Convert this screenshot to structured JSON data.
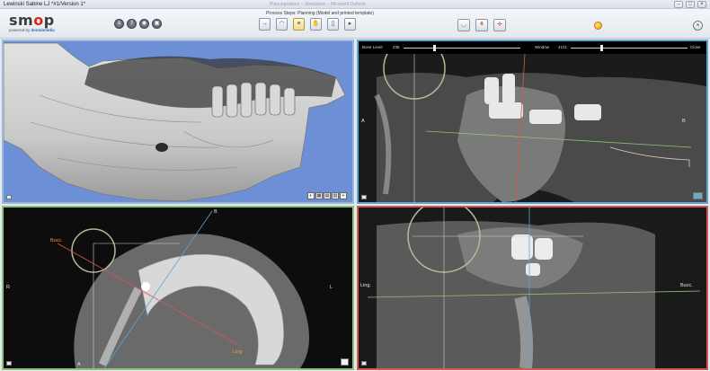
{
  "window": {
    "title": "Lewinski Sabine  LJ  *#1/Version 1*",
    "center_caption": "Planungsdaten – Simulation – Microsoft Outlook",
    "controls": [
      "–",
      "□",
      "×"
    ]
  },
  "logo": {
    "wordmark_left": "sm",
    "wordmark_o": "o",
    "wordmark_right": "p",
    "tagline_prefix": "powered by ",
    "tagline_brand": "dentalmedia"
  },
  "toolbar": {
    "left_buttons": [
      {
        "name": "menu-button",
        "icon": "menu-icon",
        "glyph": "≡"
      },
      {
        "name": "help-button",
        "icon": "help-icon",
        "glyph": "?"
      },
      {
        "name": "visibility-button",
        "icon": "eye-icon",
        "glyph": "◉"
      },
      {
        "name": "camera-button",
        "icon": "camera-icon",
        "glyph": "▣"
      }
    ],
    "process_label": "Process Steps: Planning (Model and printed template)",
    "process_steps": [
      {
        "name": "step-implant",
        "icon": "implant-icon",
        "glyph": "→"
      },
      {
        "name": "step-model",
        "icon": "model-icon",
        "glyph": "◠"
      },
      {
        "name": "step-teeth",
        "icon": "teeth-icon",
        "glyph": "≡"
      },
      {
        "name": "step-hand",
        "icon": "hand-icon",
        "glyph": "✋"
      },
      {
        "name": "step-template",
        "icon": "template-icon",
        "glyph": "▯"
      },
      {
        "name": "step-export",
        "icon": "export-icon",
        "glyph": "▸"
      }
    ],
    "right_buttons": [
      {
        "name": "panorama-button",
        "icon": "panorama-icon",
        "glyph": "◡"
      },
      {
        "name": "tooth-button",
        "icon": "tooth-icon",
        "glyph": "⚘"
      },
      {
        "name": "crosshair-button",
        "icon": "crosshair-icon",
        "glyph": "✛"
      }
    ],
    "close_glyph": "×"
  },
  "colors": {
    "status_light": "#f0a400",
    "view3d_border": "#9fb9d8",
    "sagittal_border": "#5aa7d6",
    "axial_border": "#8cc27a",
    "coronal_border": "#d6594f"
  },
  "view_3d": {
    "tools": [
      "◐",
      "▦",
      "▤",
      "▥",
      "+"
    ]
  },
  "sagittal": {
    "bone_level_label": "Bone Level",
    "bone_level_value": "236",
    "window_label": "Window",
    "window_value": "4121",
    "close_label": "Close",
    "bone_level_fraction": 0.25,
    "window_fraction": 0.25,
    "label_left": "A",
    "label_right": "B"
  },
  "axial": {
    "label_top": "B",
    "label_bucc": "Bucc.",
    "label_left": "R",
    "label_right": "L",
    "label_ling": "Ling",
    "label_bottom": "A"
  },
  "coronal": {
    "label_left": "Ling.",
    "label_right": "Bucc."
  }
}
